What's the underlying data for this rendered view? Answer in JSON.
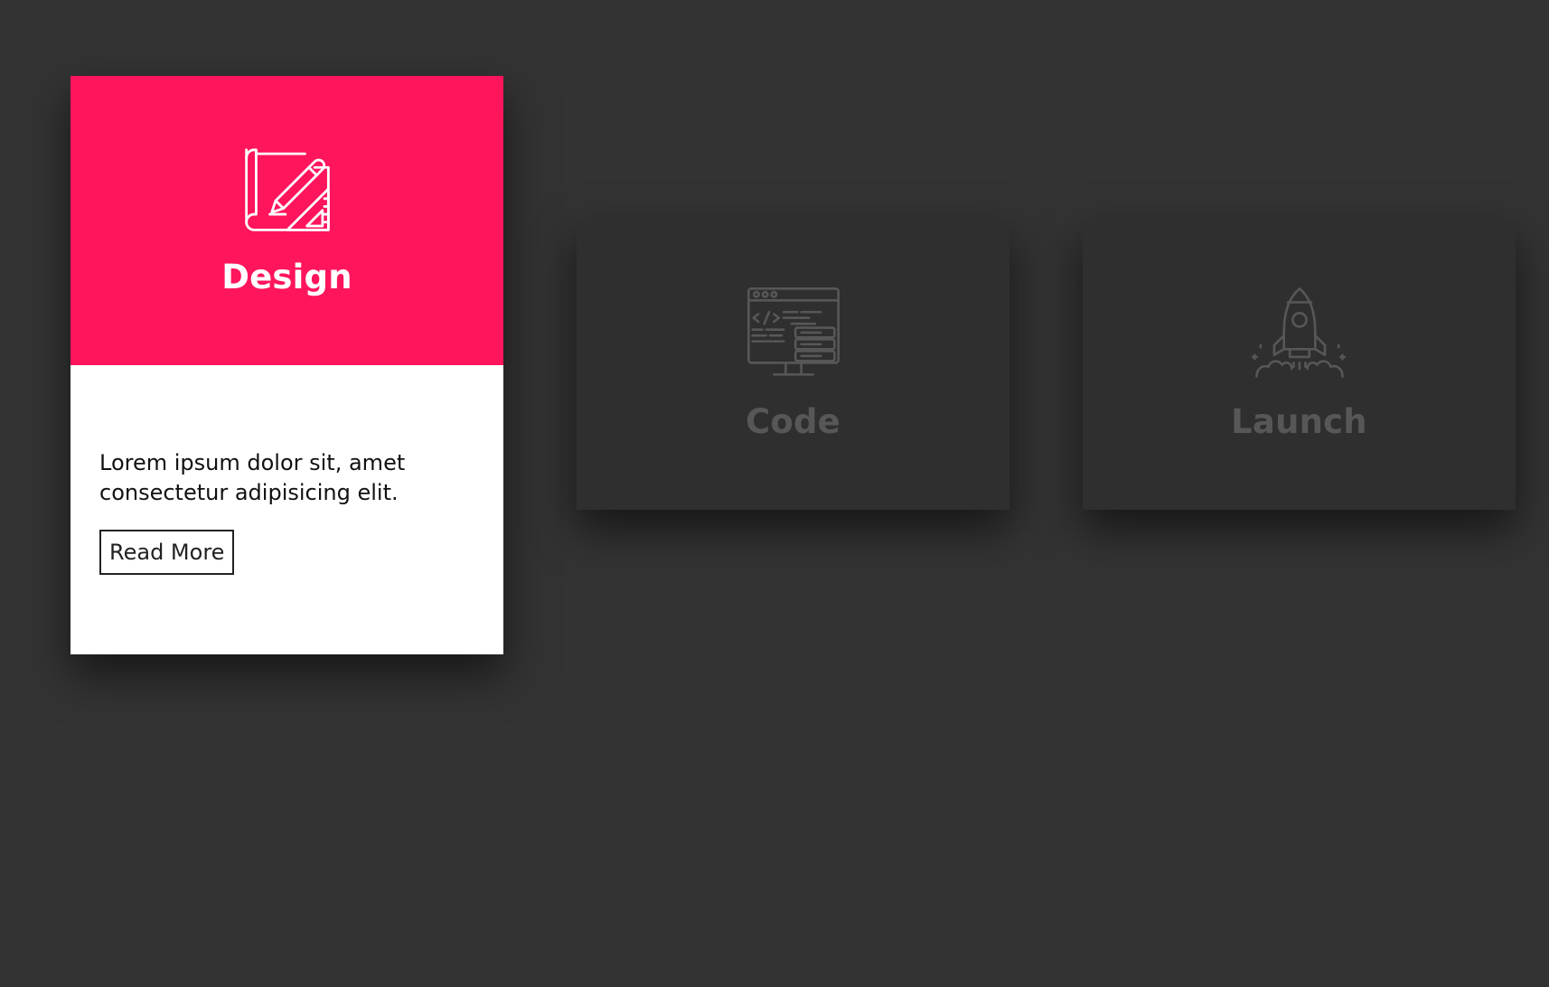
{
  "colors": {
    "background": "#333333",
    "accent": "#ff155c",
    "inactive_card": "#2f2f2f",
    "inactive_text": "#575757"
  },
  "cards": [
    {
      "title": "Design",
      "icon": "blueprint-pencil-icon",
      "text": "Lorem ipsum dolor sit, amet consectetur adipisicing elit.",
      "button_label": "Read More",
      "state": "active"
    },
    {
      "title": "Code",
      "icon": "code-monitor-icon",
      "state": "inactive"
    },
    {
      "title": "Launch",
      "icon": "rocket-launch-icon",
      "state": "inactive"
    }
  ]
}
